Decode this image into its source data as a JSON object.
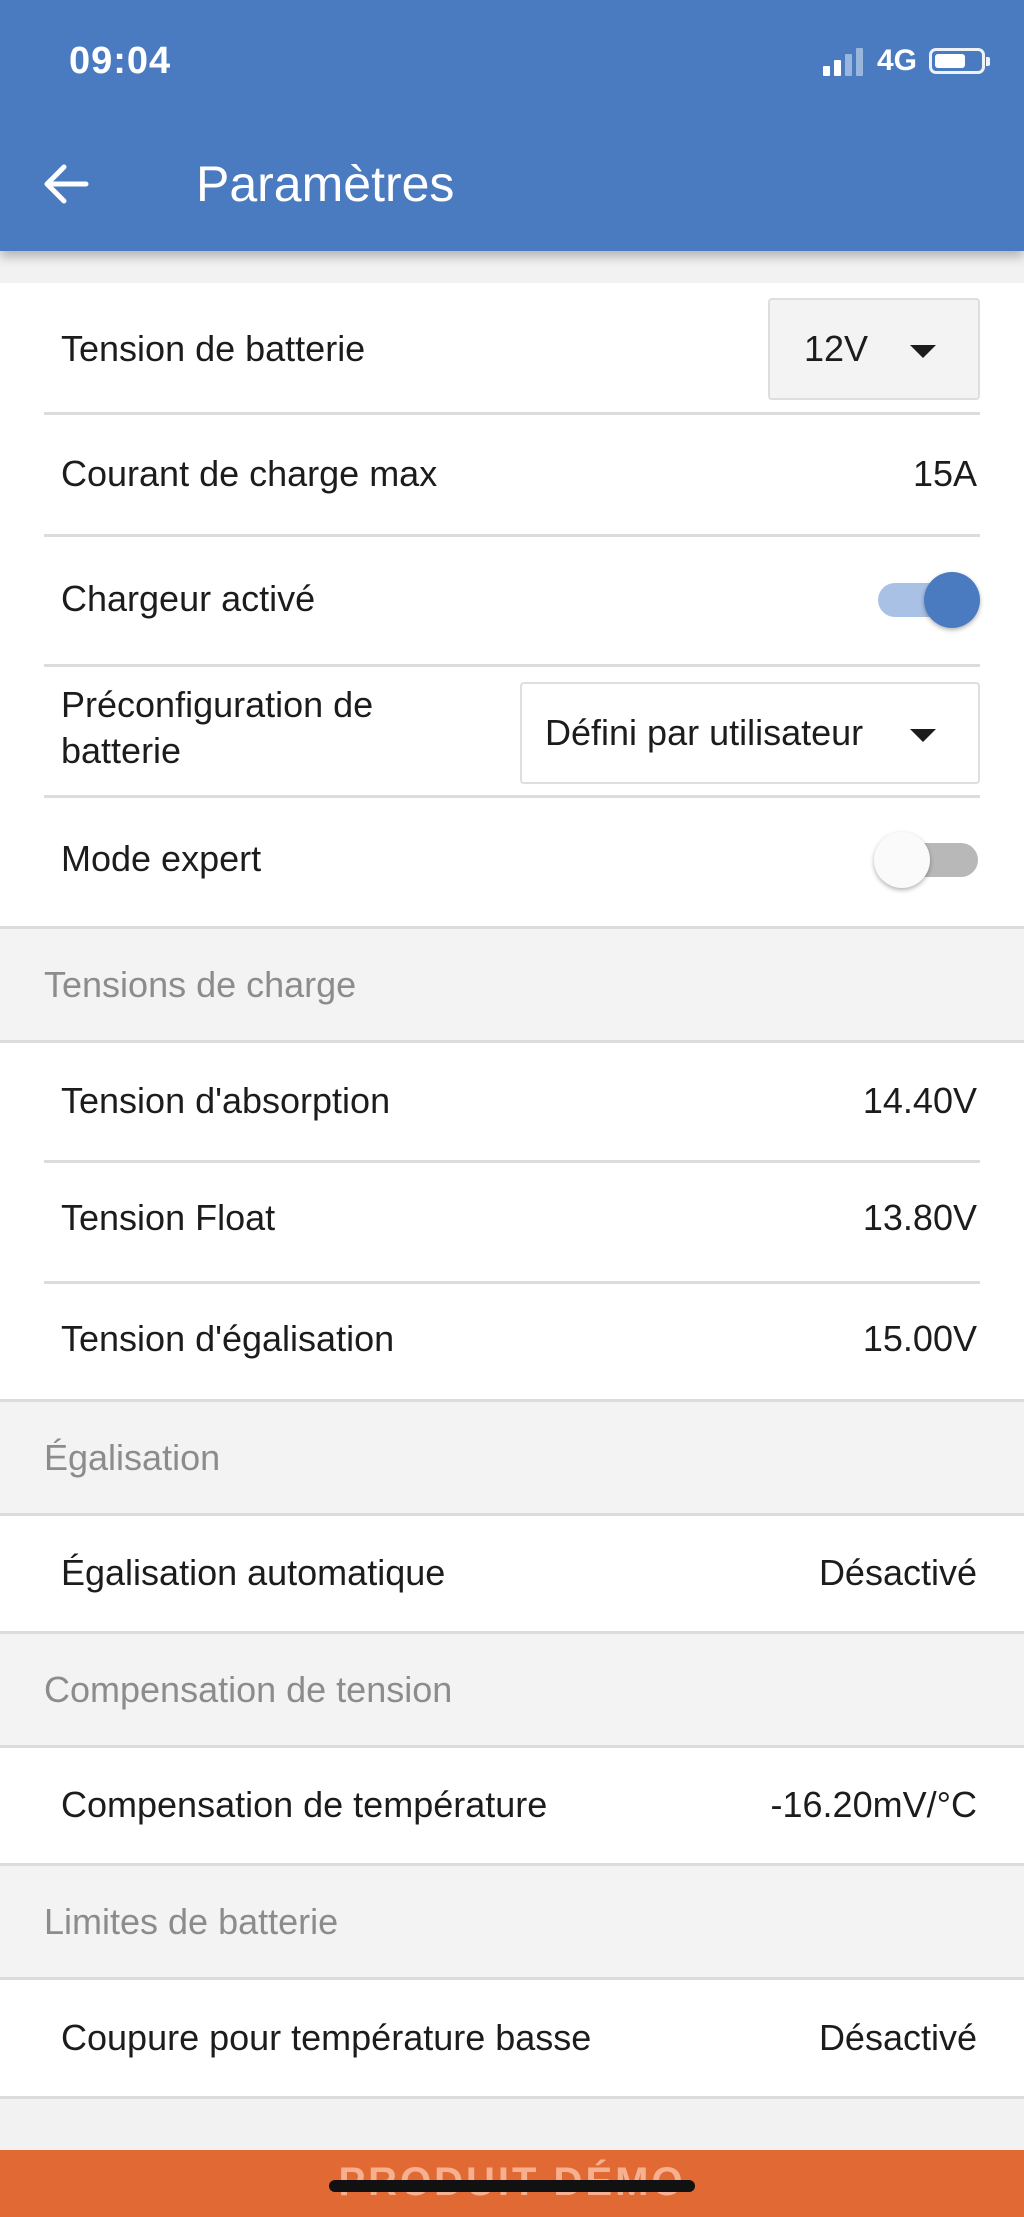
{
  "status_bar": {
    "time": "09:04",
    "network": "4G"
  },
  "header": {
    "title": "Paramètres"
  },
  "settings": {
    "battery_voltage": {
      "label": "Tension de batterie",
      "value": "12V"
    },
    "max_charge_current": {
      "label": "Courant de charge max",
      "value": "15A"
    },
    "charger_enabled": {
      "label": "Chargeur activé",
      "on": true
    },
    "battery_preset": {
      "label_line1": "Préconfiguration de",
      "label_line2": "batterie",
      "value": "Défini par utilisateur"
    },
    "expert_mode": {
      "label": "Mode expert",
      "on": false
    }
  },
  "charge_voltages": {
    "title": "Tensions de charge",
    "rows": [
      {
        "label": "Tension d'absorption",
        "value": "14.40V"
      },
      {
        "label": "Tension Float",
        "value": "13.80V"
      },
      {
        "label": "Tension d'égalisation",
        "value": "15.00V"
      }
    ]
  },
  "equalization": {
    "title": "Égalisation",
    "rows": [
      {
        "label": "Égalisation automatique",
        "value": "Désactivé"
      }
    ]
  },
  "voltage_compensation": {
    "title": "Compensation de tension",
    "rows": [
      {
        "label": "Compensation de température",
        "value": "-16.20mV/°C"
      }
    ]
  },
  "battery_limits": {
    "title": "Limites de batterie",
    "rows": [
      {
        "label": "Coupure pour température basse",
        "value": "Désactivé"
      }
    ]
  },
  "footer": {
    "banner": "PRODUIT DÉMO"
  },
  "colors": {
    "header": "#4a7bc1",
    "accent": "#4a7bc1",
    "banner": "#e16a34"
  }
}
